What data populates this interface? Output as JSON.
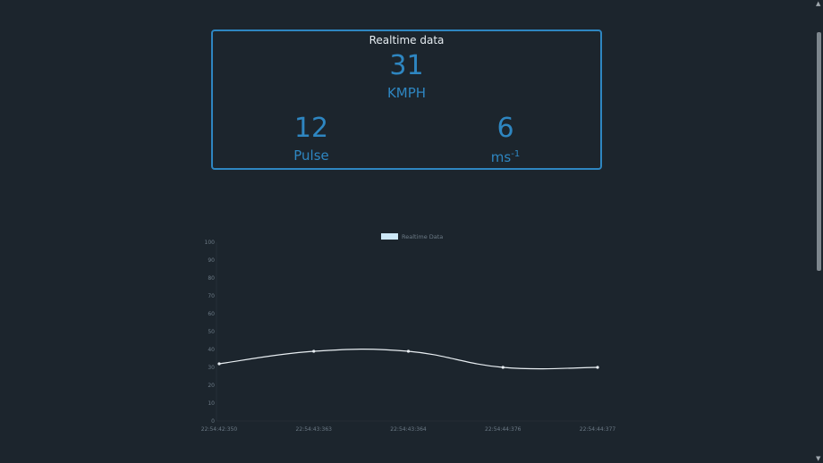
{
  "card": {
    "title": "Realtime data",
    "speed": {
      "value": "31",
      "unit": "KMPH"
    },
    "pulse": {
      "value": "12",
      "unit": "Pulse"
    },
    "accel": {
      "value": "6",
      "unit_base": "ms",
      "unit_exp": "-1"
    }
  },
  "colors": {
    "background": "#1c252d",
    "accent": "#2e86c1",
    "line": "#e8eef2",
    "legend_swatch": "#cde8f7"
  },
  "chart_data": {
    "type": "line",
    "categories": [
      "22:54:42:350",
      "22:54:43:363",
      "22:54:43:364",
      "22:54:44:376",
      "22:54:44:377"
    ],
    "series": [
      {
        "name": "Realtime Data",
        "values": [
          32,
          39,
          39,
          30,
          30
        ]
      }
    ],
    "ylim": [
      0,
      100
    ],
    "yticks": [
      "100",
      "90",
      "80",
      "70",
      "60",
      "50",
      "40",
      "30",
      "20",
      "10",
      "0"
    ],
    "grid": false,
    "legend_position": "top-center"
  }
}
